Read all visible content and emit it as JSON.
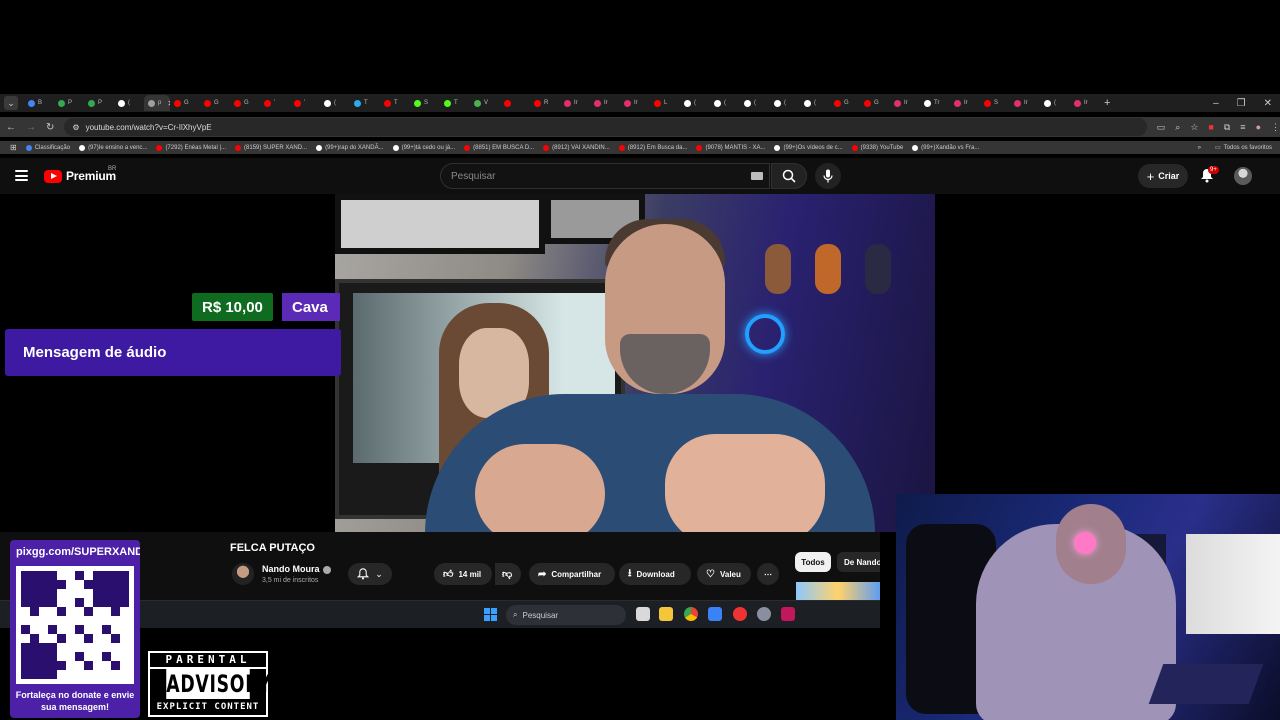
{
  "browser": {
    "tabs": [
      {
        "label": "B",
        "color": "#4285f4"
      },
      {
        "label": "P",
        "color": "#34a853"
      },
      {
        "label": "P",
        "color": "#34a853"
      },
      {
        "label": "(",
        "color": "#ffffff"
      },
      {
        "label": "p",
        "color": "#9e9e9e",
        "active": true
      },
      {
        "label": "G",
        "color": "#ff0000"
      },
      {
        "label": "G",
        "color": "#ff0000"
      },
      {
        "label": "G",
        "color": "#ff0000"
      },
      {
        "label": "'",
        "color": "#ff0000"
      },
      {
        "label": "'",
        "color": "#ff0000"
      },
      {
        "label": "(",
        "color": "#ffffff"
      },
      {
        "label": "T",
        "color": "#2aabee"
      },
      {
        "label": "T",
        "color": "#ff0000"
      },
      {
        "label": "S",
        "color": "#53fc18"
      },
      {
        "label": "T",
        "color": "#53fc18"
      },
      {
        "label": "V",
        "color": "#4caf50"
      },
      {
        "label": "",
        "color": "#ff0000"
      },
      {
        "label": "R",
        "color": "#ff0000"
      },
      {
        "label": "Ir",
        "color": "#e1306c"
      },
      {
        "label": "Ir",
        "color": "#e1306c"
      },
      {
        "label": "Ir",
        "color": "#e1306c"
      },
      {
        "label": "L",
        "color": "#ff0000"
      },
      {
        "label": "(",
        "color": "#ffffff"
      },
      {
        "label": "(",
        "color": "#ffffff"
      },
      {
        "label": "(",
        "color": "#ffffff"
      },
      {
        "label": "(",
        "color": "#ffffff"
      },
      {
        "label": "(",
        "color": "#ffffff"
      },
      {
        "label": "G",
        "color": "#ff0000"
      },
      {
        "label": "G",
        "color": "#ff0000"
      },
      {
        "label": "Ir",
        "color": "#e1306c"
      },
      {
        "label": "Tr",
        "color": "#ffffff"
      },
      {
        "label": "Ir",
        "color": "#e1306c"
      },
      {
        "label": "S",
        "color": "#ff0000"
      },
      {
        "label": "Ir",
        "color": "#e1306c"
      },
      {
        "label": "(",
        "color": "#ffffff"
      },
      {
        "label": "Ir",
        "color": "#e1306c"
      }
    ],
    "url": "youtube.com/watch?v=Cr-IlXhyVpE",
    "bookmarks": [
      {
        "label": "Classificação",
        "color": "#4285f4"
      },
      {
        "label": "(97)Ie ensino a venc...",
        "color": "#ffffff"
      },
      {
        "label": "(7292) Enéas Metal |...",
        "color": "#ff0000"
      },
      {
        "label": "(8159) SUPER XAND...",
        "color": "#ff0000"
      },
      {
        "label": "(99+)rap do XANDÃ...",
        "color": "#ffffff"
      },
      {
        "label": "(99+)tá cedo ou já...",
        "color": "#ffffff"
      },
      {
        "label": "(8851) EM BUSCA D...",
        "color": "#ff0000"
      },
      {
        "label": "(8912) VAI XANDIN...",
        "color": "#ff0000"
      },
      {
        "label": "(8912) Em Busca da...",
        "color": "#ff0000"
      },
      {
        "label": "(9078) MANTIS - XA...",
        "color": "#ff0000"
      },
      {
        "label": "(99+)Os vídeos de c...",
        "color": "#ffffff"
      },
      {
        "label": "(9338) YouTube",
        "color": "#ff0000"
      },
      {
        "label": "(99+)Xandão vs Fra...",
        "color": "#ffffff"
      }
    ],
    "all_favorites": "Todos os favoritos"
  },
  "youtube": {
    "logo": "Premium",
    "country": "BR",
    "search_placeholder": "Pesquisar",
    "create_label": "Criar",
    "notification_count": "9+"
  },
  "overlay": {
    "donation_amount": "R$ 10,00",
    "donor_name": "Cava",
    "audio_message": "Mensagem de áudio"
  },
  "video": {
    "title": "FELCA PUTAÇO",
    "channel": "Nando Moura",
    "subscribers": "3,5 mi de inscritos",
    "likes": "14 mil",
    "share_label": "Compartilhar",
    "download_label": "Download",
    "thanks_label": "Valeu",
    "chip_all": "Todos",
    "chip_from": "De Nando"
  },
  "taskbar": {
    "search_placeholder": "Pesquisar"
  },
  "pix": {
    "url": "pixgg.com/SUPERXANDÃO",
    "message": "Fortaleça no donate e envie sua mensagem!"
  },
  "advisory": {
    "top": "PARENTAL",
    "middle": "ADVISORY",
    "bottom": "EXPLICIT CONTENT"
  },
  "colors": {
    "youtube_red": "#ff0000",
    "overlay_purple": "#3d1aa1",
    "donation_green": "#0e6b1f"
  }
}
